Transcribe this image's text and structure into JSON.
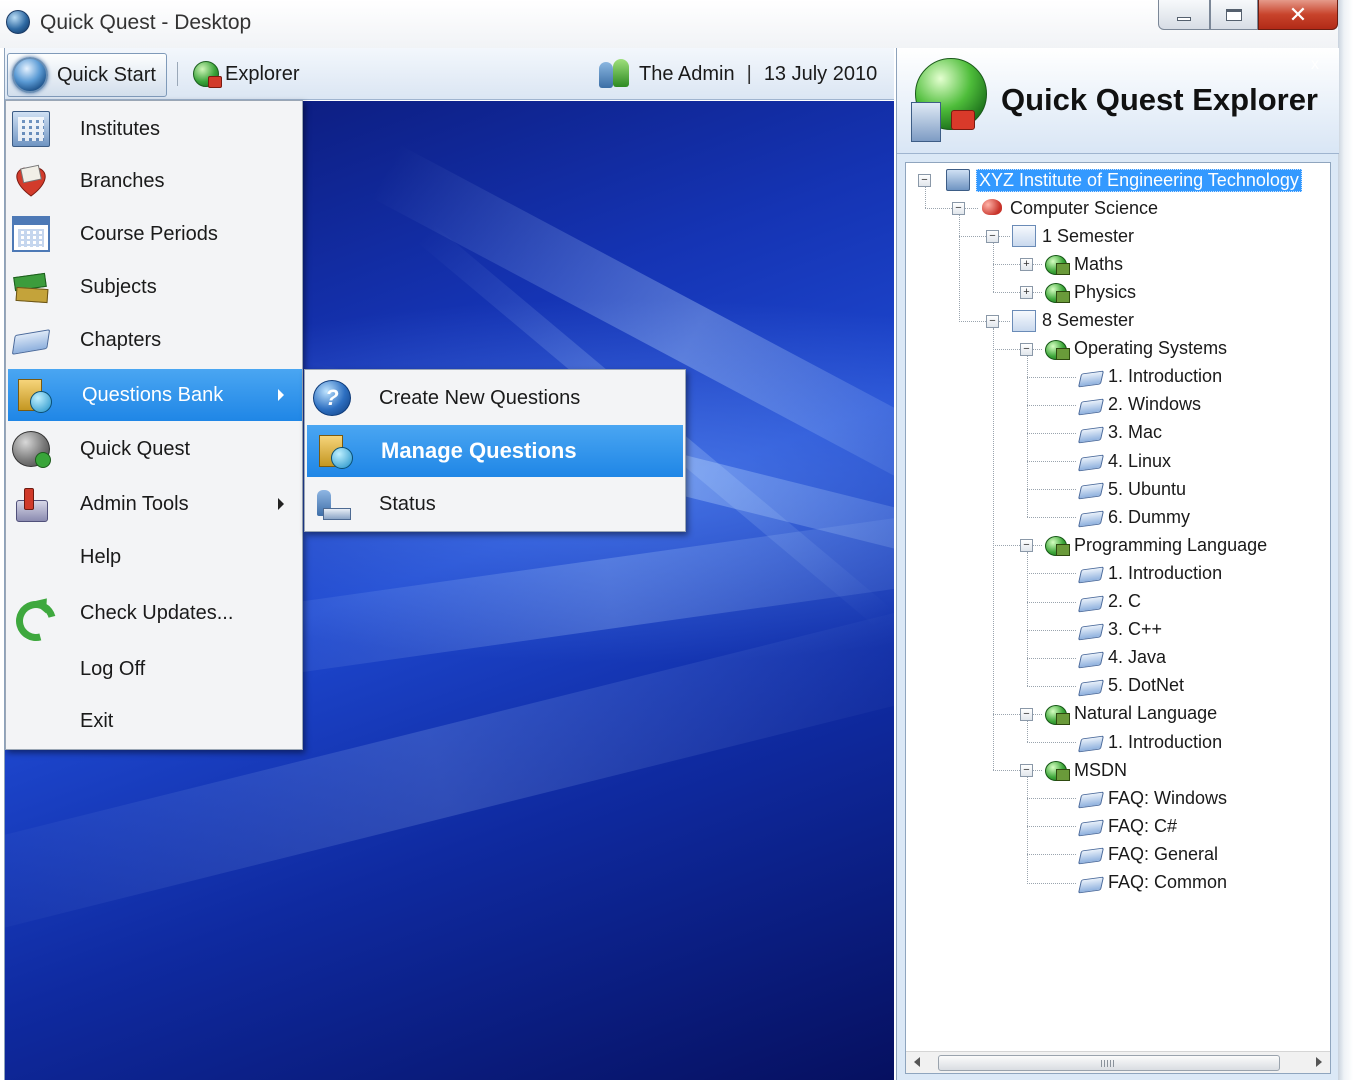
{
  "window": {
    "title": "Quick Quest - Desktop",
    "controls": [
      "minimize",
      "maximize",
      "close"
    ]
  },
  "toolbar": {
    "quick_start_label": "Quick Start",
    "explorer_label": "Explorer",
    "user_name": "The Admin",
    "separator": "|",
    "date": "13 July 2010"
  },
  "start_menu": {
    "items": [
      {
        "label": "Institutes",
        "icon": "building-icon",
        "submenu": false
      },
      {
        "label": "Branches",
        "icon": "branch-icon",
        "submenu": false
      },
      {
        "label": "Course Periods",
        "icon": "calendar-icon",
        "submenu": false
      },
      {
        "label": "Subjects",
        "icon": "books-icon",
        "submenu": false
      },
      {
        "label": "Chapters",
        "icon": "book-icon",
        "submenu": false
      },
      {
        "label": "Questions Bank",
        "icon": "questions-bank-icon",
        "submenu": true,
        "selected": true
      },
      {
        "label": "Quick Quest",
        "icon": "globe-icon",
        "submenu": false
      },
      {
        "label": "Admin Tools",
        "icon": "admin-tools-icon",
        "submenu": true
      },
      {
        "label": "Help",
        "icon": "",
        "submenu": false
      },
      {
        "label": "Check Updates...",
        "icon": "update-icon",
        "submenu": false
      },
      {
        "label": "Log Off",
        "icon": "",
        "submenu": false
      },
      {
        "label": "Exit",
        "icon": "",
        "submenu": false
      }
    ]
  },
  "submenu": {
    "items": [
      {
        "label": "Create New Questions",
        "icon": "help-icon"
      },
      {
        "label": "Manage Questions",
        "icon": "questions-bank-icon",
        "selected": true
      },
      {
        "label": "Status",
        "icon": "status-icon"
      }
    ]
  },
  "explorer": {
    "title": "Quick Quest Explorer",
    "close_glyph": "x",
    "tree": [
      {
        "label": "XYZ Institute of Engineering Technology",
        "level": 0,
        "type": "institute",
        "expander": "minus",
        "selected": true
      },
      {
        "label": "Computer Science",
        "level": 1,
        "type": "branch",
        "expander": "minus"
      },
      {
        "label": "1 Semester",
        "level": 2,
        "type": "semester",
        "expander": "minus"
      },
      {
        "label": "Maths",
        "level": 3,
        "type": "subject",
        "expander": "plus"
      },
      {
        "label": "Physics",
        "level": 3,
        "type": "subject",
        "expander": "plus"
      },
      {
        "label": "8 Semester",
        "level": 2,
        "type": "semester",
        "expander": "minus"
      },
      {
        "label": "Operating Systems",
        "level": 3,
        "type": "subject",
        "expander": "minus"
      },
      {
        "label": "1. Introduction",
        "level": 4,
        "type": "chapter"
      },
      {
        "label": "2. Windows",
        "level": 4,
        "type": "chapter"
      },
      {
        "label": "3. Mac",
        "level": 4,
        "type": "chapter"
      },
      {
        "label": "4. Linux",
        "level": 4,
        "type": "chapter"
      },
      {
        "label": "5. Ubuntu",
        "level": 4,
        "type": "chapter"
      },
      {
        "label": "6. Dummy",
        "level": 4,
        "type": "chapter"
      },
      {
        "label": "Programming Language",
        "level": 3,
        "type": "subject",
        "expander": "minus"
      },
      {
        "label": "1. Introduction",
        "level": 4,
        "type": "chapter"
      },
      {
        "label": "2. C",
        "level": 4,
        "type": "chapter"
      },
      {
        "label": "3. C++",
        "level": 4,
        "type": "chapter"
      },
      {
        "label": "4. Java",
        "level": 4,
        "type": "chapter"
      },
      {
        "label": "5. DotNet",
        "level": 4,
        "type": "chapter"
      },
      {
        "label": "Natural Language",
        "level": 3,
        "type": "subject",
        "expander": "minus"
      },
      {
        "label": "1. Introduction",
        "level": 4,
        "type": "chapter"
      },
      {
        "label": "MSDN",
        "level": 3,
        "type": "subject",
        "expander": "minus"
      },
      {
        "label": "FAQ: Windows",
        "level": 4,
        "type": "chapter"
      },
      {
        "label": "FAQ: C#",
        "level": 4,
        "type": "chapter"
      },
      {
        "label": "FAQ: General",
        "level": 4,
        "type": "chapter"
      },
      {
        "label": "FAQ: Common",
        "level": 4,
        "type": "chapter"
      }
    ]
  }
}
